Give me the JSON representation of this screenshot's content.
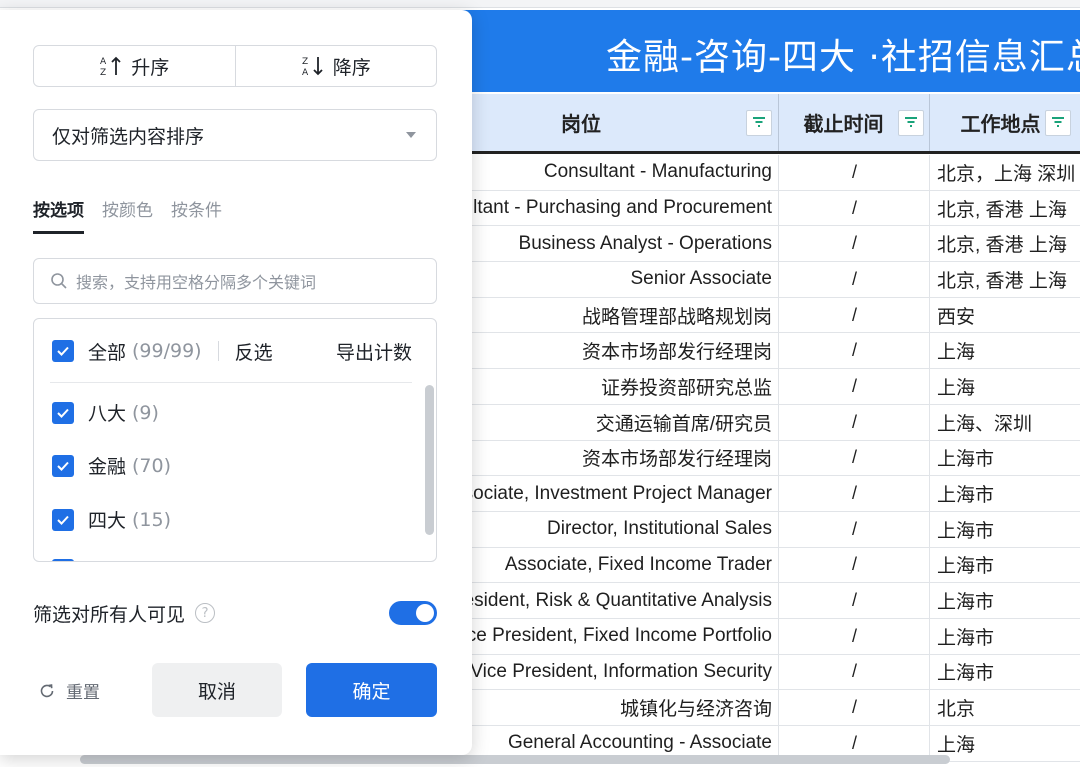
{
  "sheet": {
    "title": "金融-咨询-四大 ·社招信息汇总",
    "columns": [
      "岗位",
      "截止时间",
      "工作地点"
    ],
    "rows": [
      [
        "Consultant - Manufacturing",
        "/",
        "北京，上海 深圳"
      ],
      [
        "Consultant - Purchasing and Procurement",
        "/",
        "北京, 香港  上海"
      ],
      [
        "Business Analyst - Operations",
        "/",
        "北京, 香港  上海"
      ],
      [
        "Senior Associate",
        "/",
        "北京, 香港  上海"
      ],
      [
        "战略管理部战略规划岗",
        "/",
        "西安"
      ],
      [
        "资本市场部发行经理岗",
        "/",
        "上海"
      ],
      [
        "证券投资部研究总监",
        "/",
        "上海"
      ],
      [
        "交通运输首席/研究员",
        "/",
        "上海、深圳"
      ],
      [
        "资本市场部发行经理岗",
        "/",
        "上海市"
      ],
      [
        "Associate, Investment Project Manager",
        "/",
        "上海市"
      ],
      [
        "Director, Institutional Sales",
        "/",
        "上海市"
      ],
      [
        "Associate, Fixed Income Trader",
        "/",
        "上海市"
      ],
      [
        "Vice President, Risk & Quantitative Analysis",
        "/",
        "上海市"
      ],
      [
        "Vice President, Fixed Income Portfolio",
        "/",
        "上海市"
      ],
      [
        "Vice President, Information Security",
        "/",
        "上海市"
      ],
      [
        "城镇化与经济咨询",
        "/",
        "北京"
      ],
      [
        "General Accounting - Associate",
        "/",
        "上海"
      ]
    ]
  },
  "panel": {
    "sort_asc": "升序",
    "sort_desc": "降序",
    "sort_scope": "仅对筛选内容排序",
    "tabs": [
      "按选项",
      "按颜色",
      "按条件"
    ],
    "search_placeholder": "搜索，支持用空格分隔多个关键词",
    "all_label": "全部",
    "all_count": "(99/99)",
    "invert_label": "反选",
    "export_label": "导出计数",
    "items": [
      {
        "label": "八大",
        "count": "(9)"
      },
      {
        "label": "金融",
        "count": "(70)"
      },
      {
        "label": "四大",
        "count": "(15)"
      }
    ],
    "visible_label": "筛选对所有人可见",
    "help_glyph": "?",
    "reset_label": "重置",
    "cancel_label": "取消",
    "ok_label": "确定"
  },
  "colors": {
    "accent": "#1f6fe5",
    "title_band": "#1f7bea",
    "header_fill": "#dce9fb",
    "filter_icon": "#1aa37a"
  }
}
